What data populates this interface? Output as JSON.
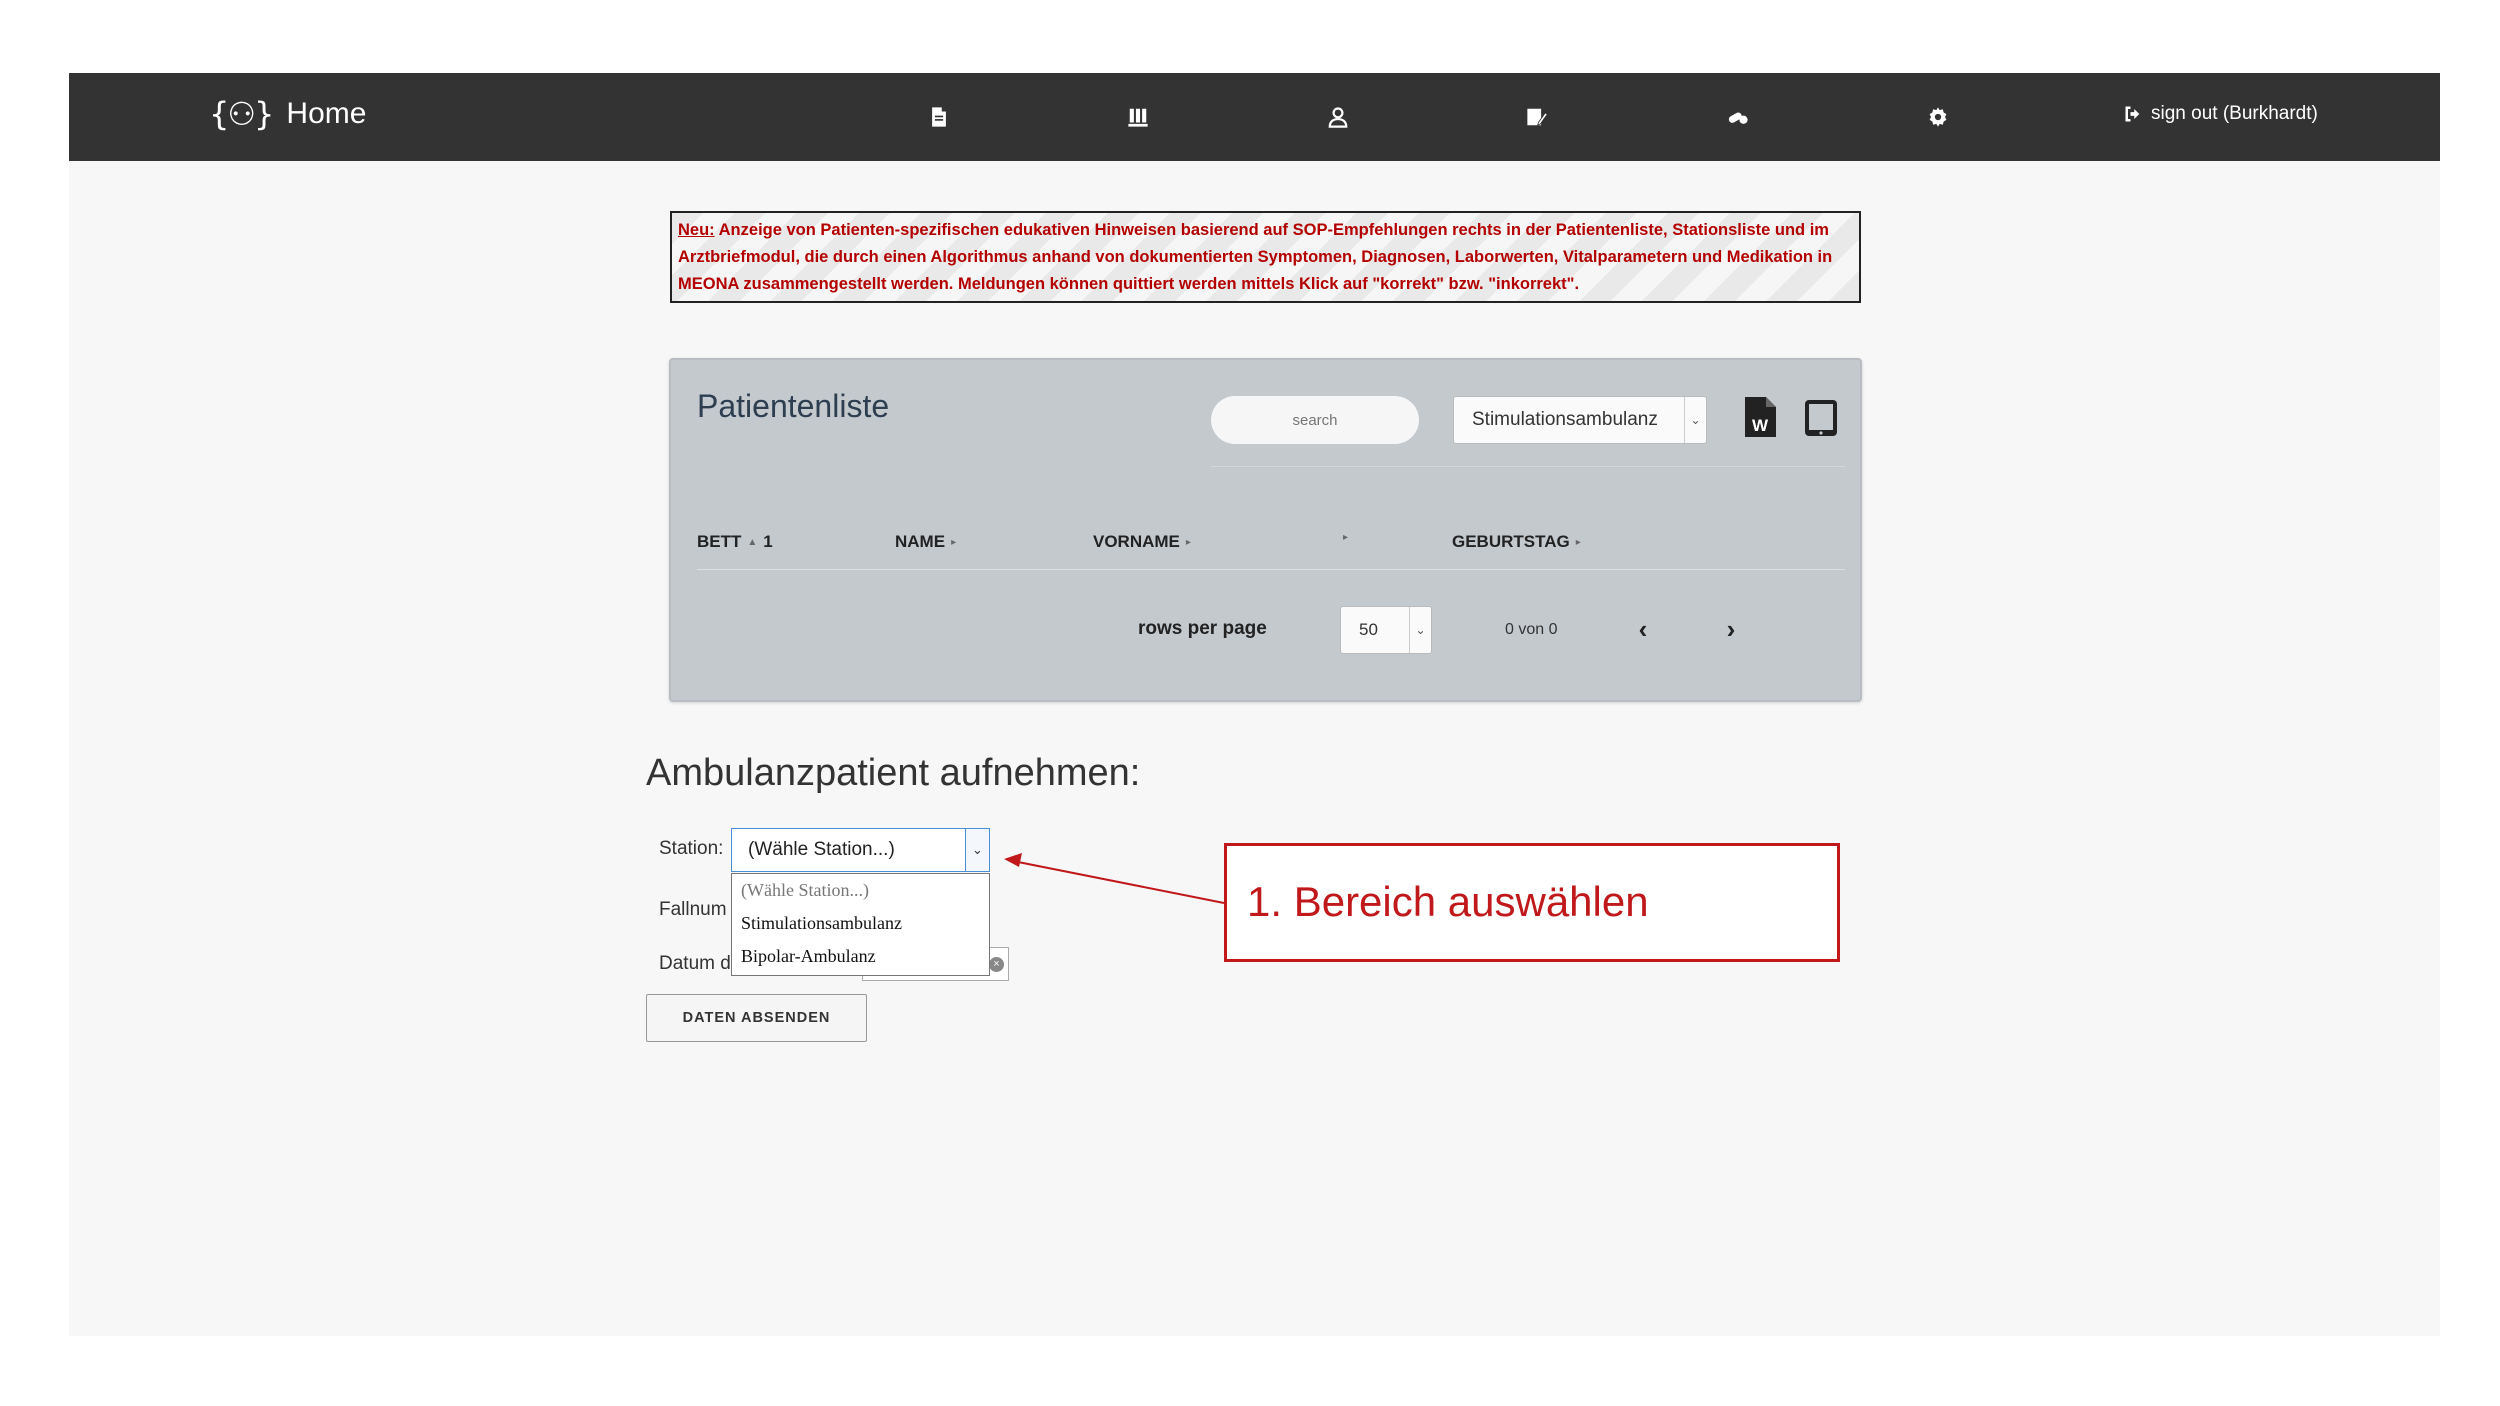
{
  "nav": {
    "brand_logo": "{⚇}",
    "brand": "Home",
    "icons": [
      "document-icon",
      "lab-tubes-icon",
      "user-icon",
      "edit-notes-icon",
      "pills-icon",
      "gear-icon"
    ],
    "signout": "sign out (Burkhardt)"
  },
  "notice": {
    "prefix": "Neu:",
    "text": " Anzeige von Patienten-spezifischen edukativen Hinweisen basierend auf SOP-Empfehlungen rechts in der Patientenliste, Stationsliste und im Arztbriefmodul, die durch einen Algorithmus anhand von dokumentierten Symptomen, Diagnosen, Laborwerten, Vitalparametern und Medikation in MEONA zusammengestellt werden. Meldungen können quittiert werden mittels Klick auf \"korrekt\" bzw. \"inkorrekt\"."
  },
  "patient_list": {
    "title": "Patientenliste",
    "search_placeholder": "search",
    "station_selected": "Stimulationsambulanz",
    "columns": [
      "BETT",
      "NAME",
      "VORNAME",
      "",
      "GEBURTSTAG"
    ],
    "bett_sort_index": "1",
    "rows_per_page_label": "rows per page",
    "rows_per_page": "50",
    "pager_text": "0 von 0"
  },
  "form": {
    "title": "Ambulanzpatient aufnehmen:",
    "station_label": "Station:",
    "fall_label": "Fallnum",
    "datum_label": "Datum d",
    "station_selected": "(Wähle Station...)",
    "options": [
      "(Wähle Station...)",
      "Stimulationsambulanz",
      "Bipolar-Ambulanz"
    ],
    "submit": "DATEN ABSENDEN"
  },
  "annotation": {
    "text": "1. Bereich auswählen",
    "color": "#c0181b"
  }
}
